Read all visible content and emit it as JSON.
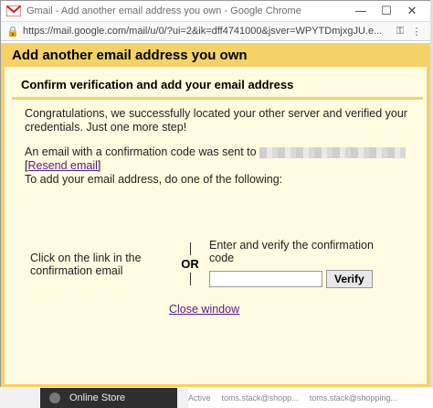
{
  "window": {
    "title": "Gmail - Add another email address you own - Google Chrome",
    "minimize": "—",
    "maximize": "☐",
    "close": "✕"
  },
  "address_bar": {
    "url": "https://mail.google.com/mail/u/0/?ui=2&ik=dff4741000&jsver=WPYTDmjxgJU.e...",
    "key_icon": "key-icon",
    "menu_icon": "⋮"
  },
  "dialog": {
    "header": "Add another email address you own",
    "subheader": "Confirm verification and add your email address",
    "congrats": "Congratulations, we successfully located your other server and verified your credentials. Just one more step!",
    "sent_text": "An email with a confirmation code was sent to",
    "resend_open": "[",
    "resend_label": "Resend email",
    "resend_close": "]",
    "instruction": "To add your email address, do one of the following:",
    "option_left": "Click on the link in the confirmation email",
    "or_label": "OR",
    "option_right": "Enter and verify the confirmation code",
    "code_placeholder": "",
    "verify_label": "Verify",
    "close_label": "Close window"
  },
  "background": {
    "sidebar_item": "Online Store",
    "row_status": "Active",
    "row_email_a": "toms.stack@shopp...",
    "row_email_b": "toms.stack@shopping..."
  },
  "colors": {
    "accent_yellow": "#f5d267",
    "panel_background": "#fffbe0",
    "link_purple": "#551a8b"
  }
}
